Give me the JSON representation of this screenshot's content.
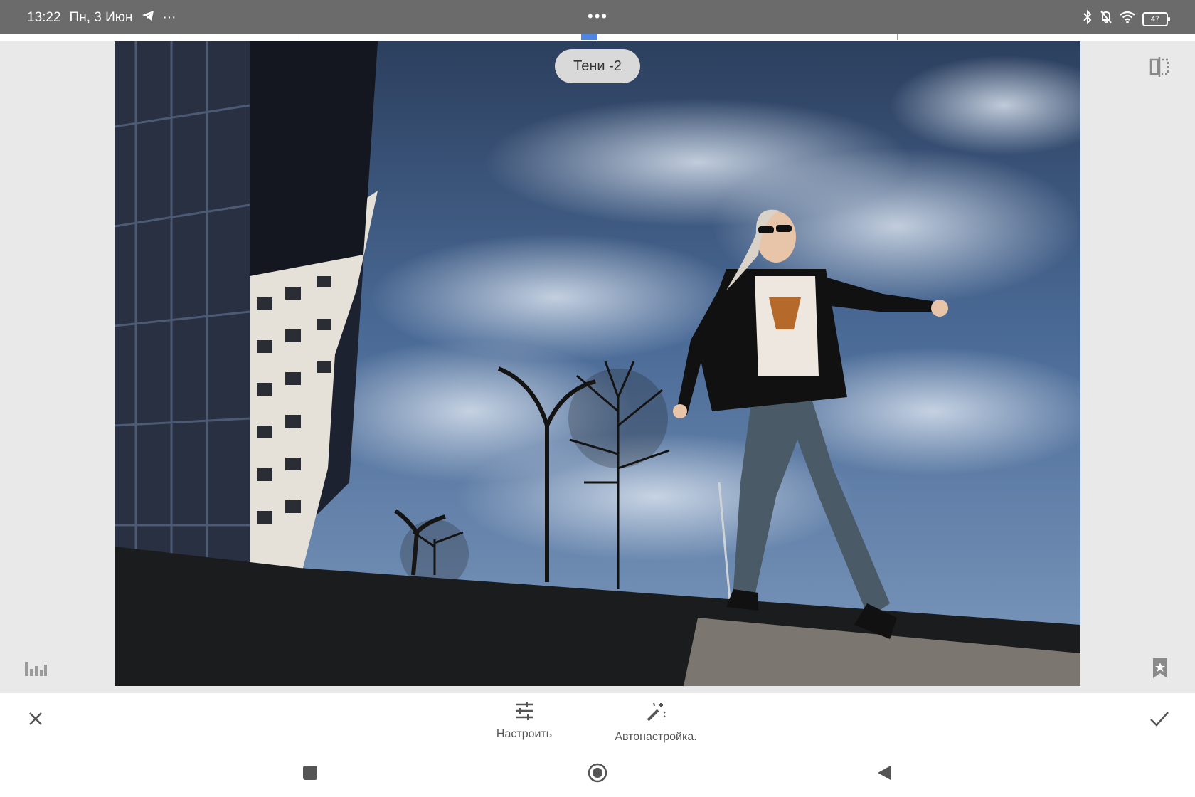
{
  "status_bar": {
    "time": "13:22",
    "date": "Пн, 3 Июн",
    "more_dots": "•••",
    "left_overflow": "···",
    "battery_level": "47",
    "icons": [
      "telegram-icon",
      "bluetooth-icon",
      "bell-off-icon",
      "wifi-icon",
      "battery-icon"
    ]
  },
  "editor": {
    "adjustment_label": "Тени -2",
    "slider_value": -2,
    "accent_color": "#4e86e6"
  },
  "toolbar": {
    "adjust_label": "Настроить",
    "auto_label": "Автонастройка.",
    "icons": [
      "close-icon",
      "sliders-icon",
      "magic-wand-icon",
      "check-icon"
    ]
  },
  "side_buttons": {
    "icons": [
      "compare-icon",
      "histogram-icon",
      "bookmark-star-icon"
    ]
  },
  "navbar": {
    "icons": [
      "recents-icon",
      "home-icon",
      "back-icon"
    ]
  }
}
